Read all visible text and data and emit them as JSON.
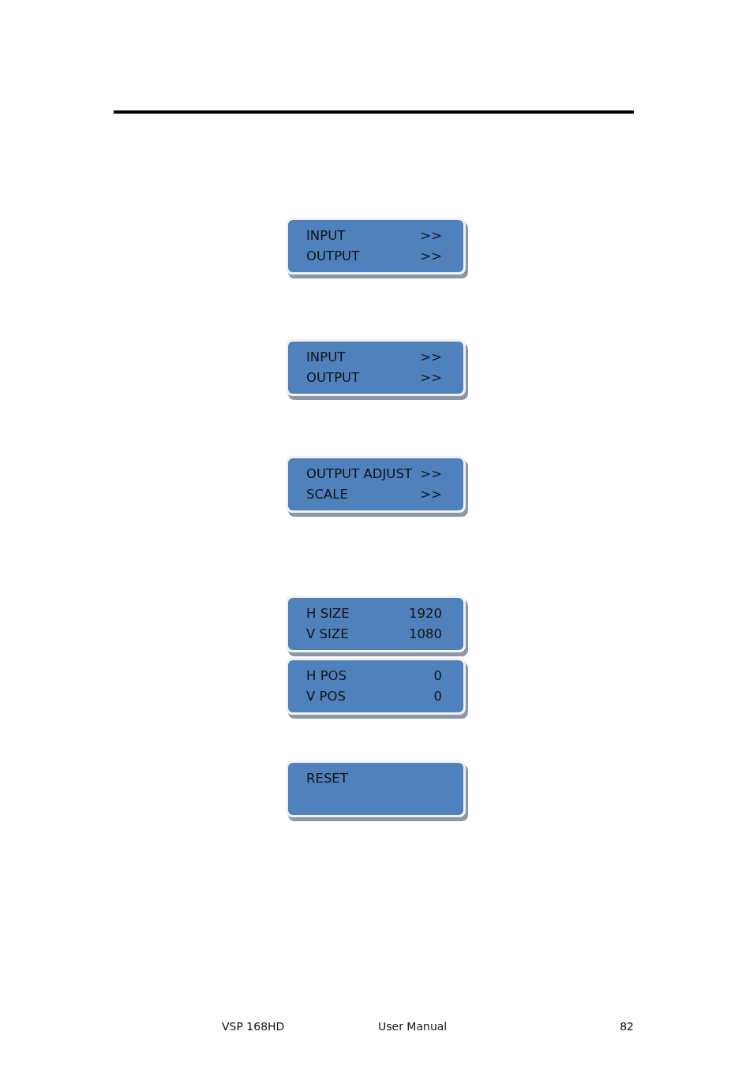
{
  "panels": [
    {
      "rows": [
        {
          "label": "INPUT",
          "value": ">>"
        },
        {
          "label": "OUTPUT",
          "value": ">>"
        }
      ]
    },
    {
      "rows": [
        {
          "label": "INPUT",
          "value": ">>"
        },
        {
          "label": "OUTPUT",
          "value": ">>"
        }
      ]
    },
    {
      "rows": [
        {
          "label": "OUTPUT ADJUST",
          "value": ">>"
        },
        {
          "label": "SCALE",
          "value": ">>"
        }
      ]
    },
    {
      "rows": [
        {
          "label": "H SIZE",
          "value": "1920"
        },
        {
          "label": "V SIZE",
          "value": "1080"
        }
      ]
    },
    {
      "rows": [
        {
          "label": "H POS",
          "value": "0"
        },
        {
          "label": "V POS",
          "value": "0"
        }
      ]
    },
    {
      "rows": [
        {
          "label": "RESET"
        }
      ]
    }
  ],
  "footer": {
    "left": "VSP 168HD",
    "center": "User Manual",
    "page_number": "82"
  }
}
